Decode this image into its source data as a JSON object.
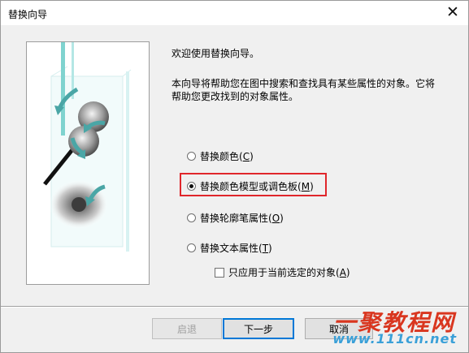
{
  "window": {
    "title": "替换向导"
  },
  "intro": {
    "welcome": "欢迎使用替换向导。",
    "description_line1": "本向导将帮助您在图中搜索和查找具有某些属性的对象。它将",
    "description_line2": "帮助您更改找到的对象属性。"
  },
  "options": [
    {
      "label": "替换颜色",
      "mnemonic": "C",
      "checked": false
    },
    {
      "label": "替换颜色模型或调色板",
      "mnemonic": "M",
      "checked": true
    },
    {
      "label": "替换轮廓笔属性",
      "mnemonic": "O",
      "checked": false
    },
    {
      "label": "替换文本属性",
      "mnemonic": "T",
      "checked": false
    }
  ],
  "checkbox": {
    "label": "只应用于当前选定的对象",
    "mnemonic": "A",
    "checked": false
  },
  "buttons": {
    "back": "启退",
    "next": "下一步",
    "cancel": "取消"
  },
  "watermark": {
    "brand": "一聚教程网",
    "url": "www.111cn.net"
  },
  "colors": {
    "highlight": "#e0262b",
    "accent": "#0078d7",
    "teal_arrow": "#4aa6a6"
  }
}
